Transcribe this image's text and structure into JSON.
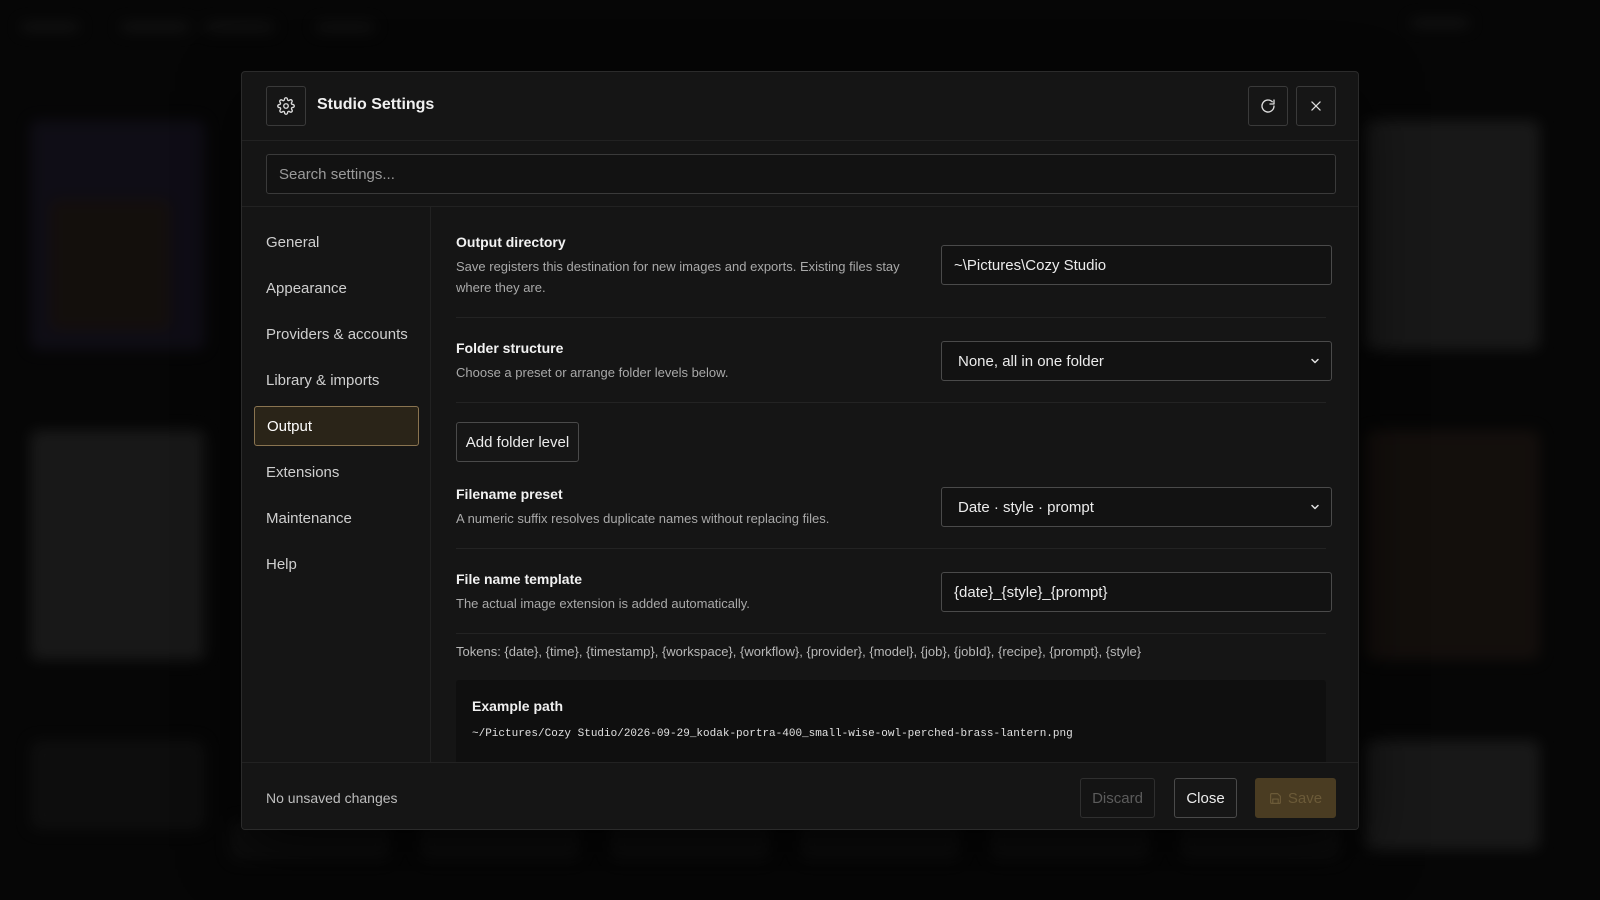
{
  "dialog": {
    "title": "Studio Settings",
    "search_placeholder": "Search settings...",
    "icons": {
      "settings": "gear-icon",
      "reload": "refresh-icon",
      "close": "close-icon",
      "select_arrow": "chevron-down-icon",
      "save": "save-icon"
    }
  },
  "sidebar": {
    "items": [
      {
        "label": "General"
      },
      {
        "label": "Appearance"
      },
      {
        "label": "Providers & accounts"
      },
      {
        "label": "Library & imports"
      },
      {
        "label": "Output",
        "active": true
      },
      {
        "label": "Extensions"
      },
      {
        "label": "Maintenance"
      },
      {
        "label": "Help"
      }
    ]
  },
  "output": {
    "directory": {
      "label": "Output directory",
      "help": "Save registers this destination for new images and exports. Existing files stay where they are.",
      "value": "~\\Pictures\\Cozy Studio"
    },
    "folder_structure": {
      "label": "Folder structure",
      "help": "Choose a preset or arrange folder levels below.",
      "selected": "None, all in one folder"
    },
    "add_folder_level_label": "Add folder level",
    "filename_preset": {
      "label": "Filename preset",
      "help": "A numeric suffix resolves duplicate names without replacing files.",
      "selected": "Date · style · prompt"
    },
    "file_name_template": {
      "label": "File name template",
      "help": "The actual image extension is added automatically.",
      "value": "{date}_{style}_{prompt}"
    },
    "tokens": "Tokens: {date}, {time}, {timestamp}, {workspace}, {workflow}, {provider}, {model}, {job}, {jobId}, {recipe}, {prompt}, {style}",
    "example": {
      "title": "Example path",
      "path": "~/Pictures/Cozy Studio/2026-09-29_kodak-portra-400_small-wise-owl-perched-brass-lantern.png"
    }
  },
  "footer": {
    "status": "No unsaved changes",
    "discard_label": "Discard",
    "close_label": "Close",
    "save_label": "Save"
  },
  "colors": {
    "accent": "#8a7450",
    "active_bg": "#2a2418",
    "save_disabled": "#4a3c22"
  }
}
